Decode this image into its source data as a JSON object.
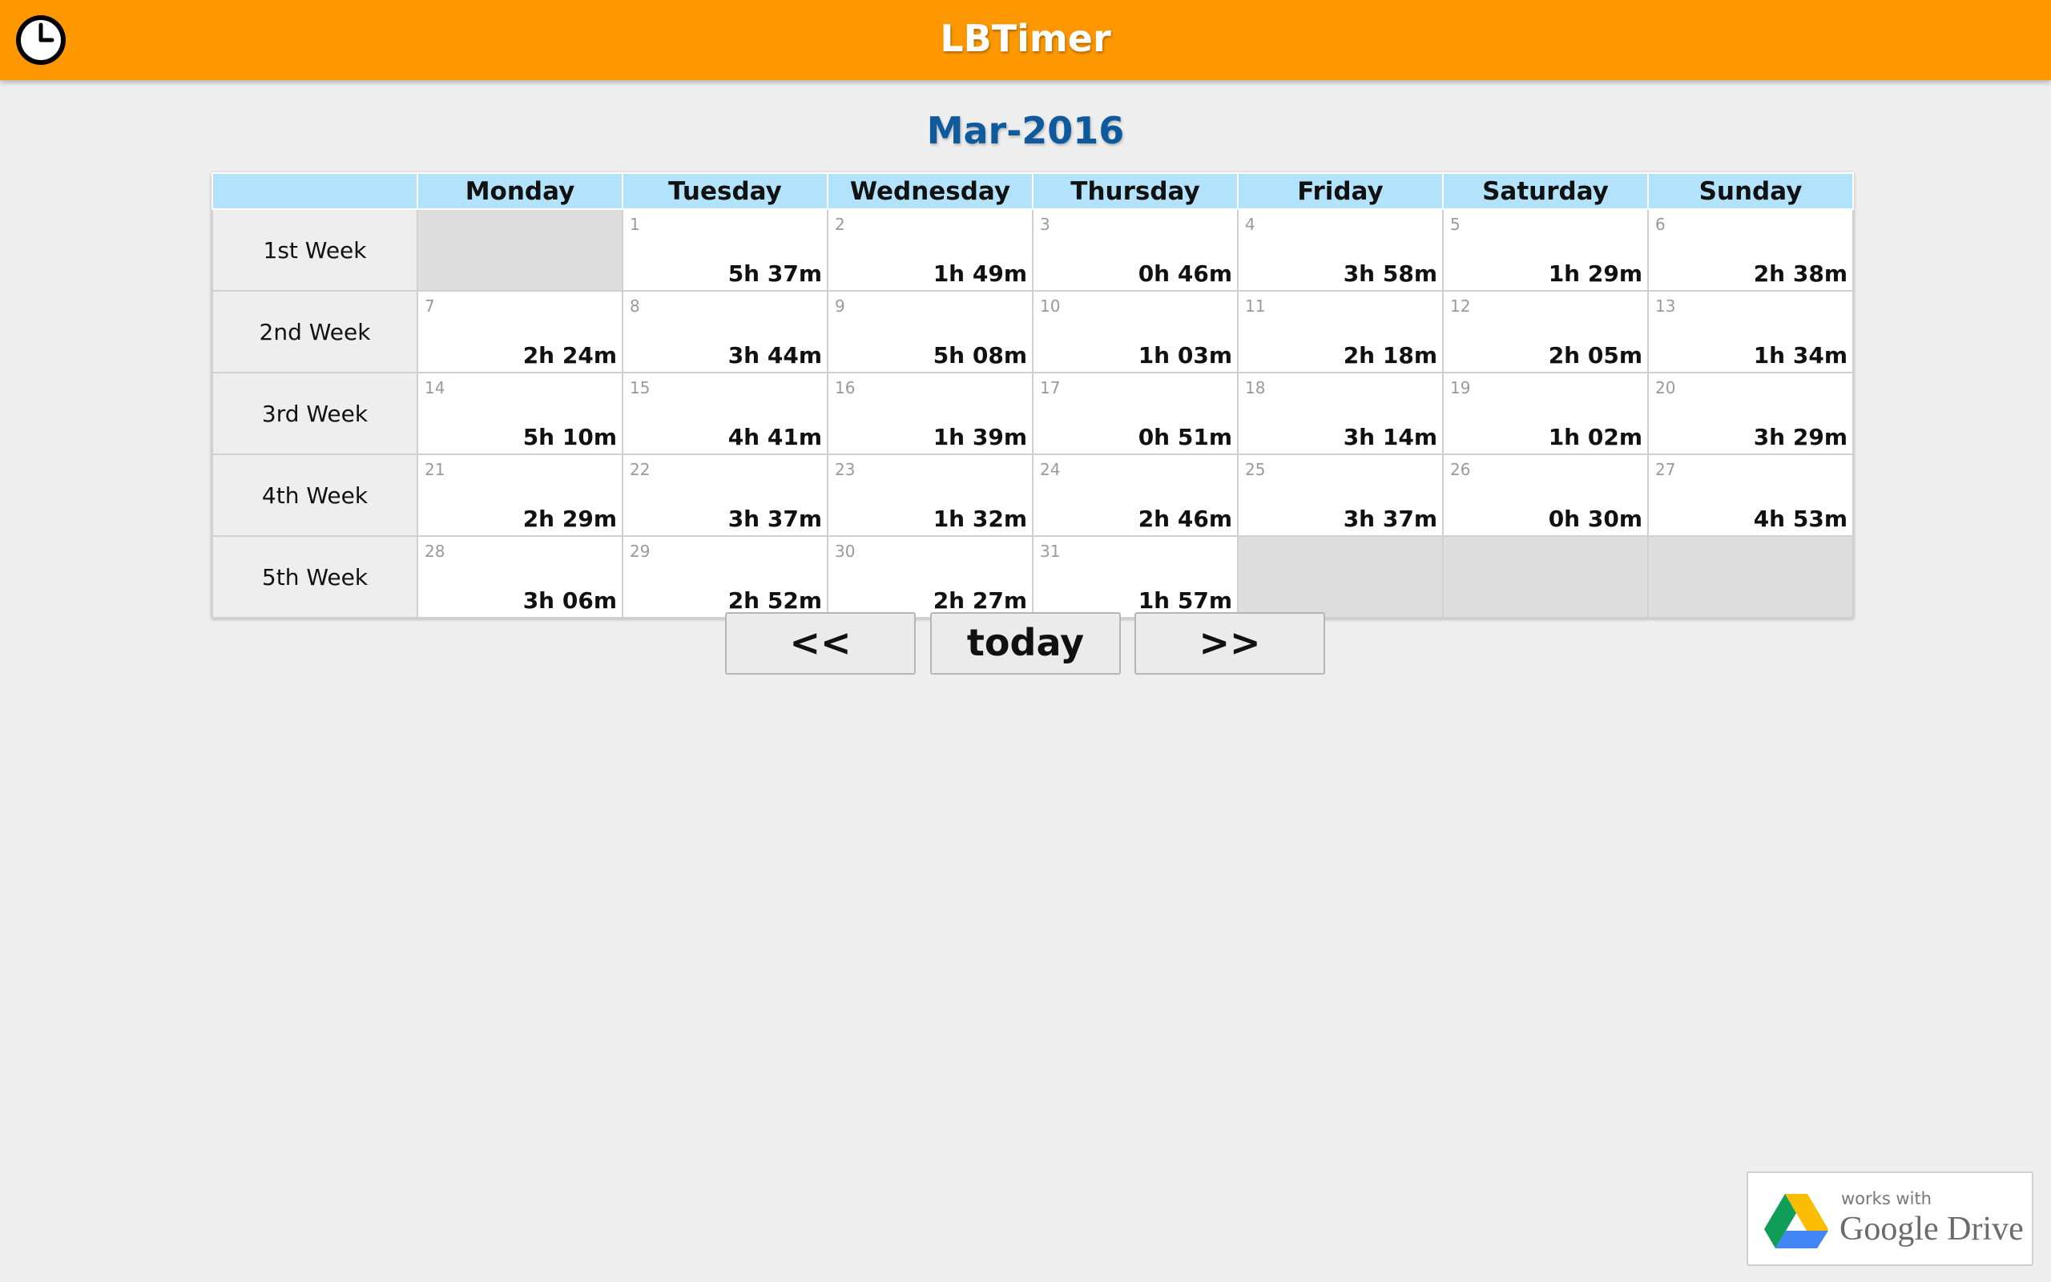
{
  "app": {
    "title": "LBTimer"
  },
  "calendar": {
    "month_title": "Mar-2016",
    "days": [
      "Monday",
      "Tuesday",
      "Wednesday",
      "Thursday",
      "Friday",
      "Saturday",
      "Sunday"
    ],
    "weeks": [
      {
        "label": "1st Week",
        "cells": [
          null,
          {
            "day": "1",
            "time": "5h 37m"
          },
          {
            "day": "2",
            "time": "1h 49m"
          },
          {
            "day": "3",
            "time": "0h 46m"
          },
          {
            "day": "4",
            "time": "3h 58m"
          },
          {
            "day": "5",
            "time": "1h 29m"
          },
          {
            "day": "6",
            "time": "2h 38m"
          }
        ]
      },
      {
        "label": "2nd Week",
        "cells": [
          {
            "day": "7",
            "time": "2h 24m"
          },
          {
            "day": "8",
            "time": "3h 44m"
          },
          {
            "day": "9",
            "time": "5h 08m"
          },
          {
            "day": "10",
            "time": "1h 03m"
          },
          {
            "day": "11",
            "time": "2h 18m"
          },
          {
            "day": "12",
            "time": "2h 05m"
          },
          {
            "day": "13",
            "time": "1h 34m"
          }
        ]
      },
      {
        "label": "3rd Week",
        "cells": [
          {
            "day": "14",
            "time": "5h 10m"
          },
          {
            "day": "15",
            "time": "4h 41m"
          },
          {
            "day": "16",
            "time": "1h 39m"
          },
          {
            "day": "17",
            "time": "0h 51m"
          },
          {
            "day": "18",
            "time": "3h 14m"
          },
          {
            "day": "19",
            "time": "1h 02m"
          },
          {
            "day": "20",
            "time": "3h 29m"
          }
        ]
      },
      {
        "label": "4th Week",
        "cells": [
          {
            "day": "21",
            "time": "2h 29m"
          },
          {
            "day": "22",
            "time": "3h 37m"
          },
          {
            "day": "23",
            "time": "1h 32m"
          },
          {
            "day": "24",
            "time": "2h 46m"
          },
          {
            "day": "25",
            "time": "3h 37m"
          },
          {
            "day": "26",
            "time": "0h 30m"
          },
          {
            "day": "27",
            "time": "4h 53m"
          }
        ]
      },
      {
        "label": "5th Week",
        "cells": [
          {
            "day": "28",
            "time": "3h 06m"
          },
          {
            "day": "29",
            "time": "2h 52m"
          },
          {
            "day": "30",
            "time": "2h 27m"
          },
          {
            "day": "31",
            "time": "1h 57m"
          },
          null,
          null,
          null
        ]
      }
    ]
  },
  "nav": {
    "prev_label": "<<",
    "today_label": "today",
    "next_label": ">>"
  },
  "badge": {
    "line1": "works with",
    "line2": "Google Drive"
  },
  "colors": {
    "header_bg": "#ff9800",
    "title_blue": "#0f5a9c",
    "day_header_bg": "#b3e3fa"
  },
  "icons": {
    "app_icon": "clock-icon",
    "badge_icon": "google-drive-icon"
  }
}
